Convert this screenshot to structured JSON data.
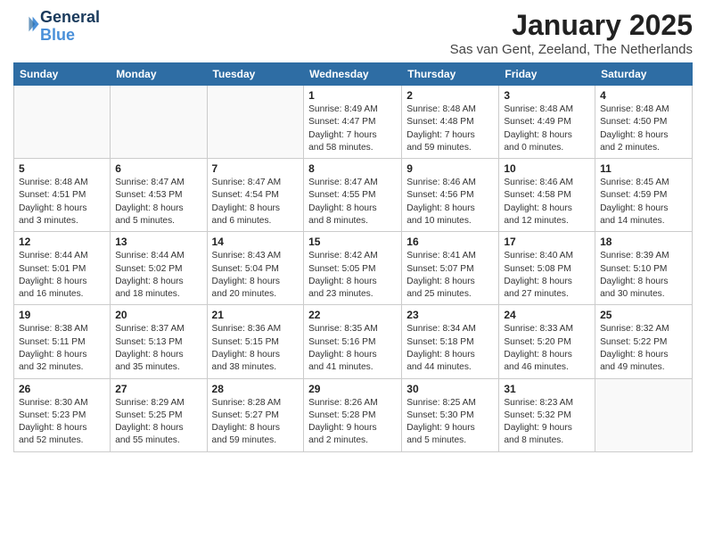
{
  "header": {
    "logo_line1": "General",
    "logo_line2": "Blue",
    "month_year": "January 2025",
    "location": "Sas van Gent, Zeeland, The Netherlands"
  },
  "weekdays": [
    "Sunday",
    "Monday",
    "Tuesday",
    "Wednesday",
    "Thursday",
    "Friday",
    "Saturday"
  ],
  "weeks": [
    [
      {
        "day": "",
        "info": ""
      },
      {
        "day": "",
        "info": ""
      },
      {
        "day": "",
        "info": ""
      },
      {
        "day": "1",
        "info": "Sunrise: 8:49 AM\nSunset: 4:47 PM\nDaylight: 7 hours\nand 58 minutes."
      },
      {
        "day": "2",
        "info": "Sunrise: 8:48 AM\nSunset: 4:48 PM\nDaylight: 7 hours\nand 59 minutes."
      },
      {
        "day": "3",
        "info": "Sunrise: 8:48 AM\nSunset: 4:49 PM\nDaylight: 8 hours\nand 0 minutes."
      },
      {
        "day": "4",
        "info": "Sunrise: 8:48 AM\nSunset: 4:50 PM\nDaylight: 8 hours\nand 2 minutes."
      }
    ],
    [
      {
        "day": "5",
        "info": "Sunrise: 8:48 AM\nSunset: 4:51 PM\nDaylight: 8 hours\nand 3 minutes."
      },
      {
        "day": "6",
        "info": "Sunrise: 8:47 AM\nSunset: 4:53 PM\nDaylight: 8 hours\nand 5 minutes."
      },
      {
        "day": "7",
        "info": "Sunrise: 8:47 AM\nSunset: 4:54 PM\nDaylight: 8 hours\nand 6 minutes."
      },
      {
        "day": "8",
        "info": "Sunrise: 8:47 AM\nSunset: 4:55 PM\nDaylight: 8 hours\nand 8 minutes."
      },
      {
        "day": "9",
        "info": "Sunrise: 8:46 AM\nSunset: 4:56 PM\nDaylight: 8 hours\nand 10 minutes."
      },
      {
        "day": "10",
        "info": "Sunrise: 8:46 AM\nSunset: 4:58 PM\nDaylight: 8 hours\nand 12 minutes."
      },
      {
        "day": "11",
        "info": "Sunrise: 8:45 AM\nSunset: 4:59 PM\nDaylight: 8 hours\nand 14 minutes."
      }
    ],
    [
      {
        "day": "12",
        "info": "Sunrise: 8:44 AM\nSunset: 5:01 PM\nDaylight: 8 hours\nand 16 minutes."
      },
      {
        "day": "13",
        "info": "Sunrise: 8:44 AM\nSunset: 5:02 PM\nDaylight: 8 hours\nand 18 minutes."
      },
      {
        "day": "14",
        "info": "Sunrise: 8:43 AM\nSunset: 5:04 PM\nDaylight: 8 hours\nand 20 minutes."
      },
      {
        "day": "15",
        "info": "Sunrise: 8:42 AM\nSunset: 5:05 PM\nDaylight: 8 hours\nand 23 minutes."
      },
      {
        "day": "16",
        "info": "Sunrise: 8:41 AM\nSunset: 5:07 PM\nDaylight: 8 hours\nand 25 minutes."
      },
      {
        "day": "17",
        "info": "Sunrise: 8:40 AM\nSunset: 5:08 PM\nDaylight: 8 hours\nand 27 minutes."
      },
      {
        "day": "18",
        "info": "Sunrise: 8:39 AM\nSunset: 5:10 PM\nDaylight: 8 hours\nand 30 minutes."
      }
    ],
    [
      {
        "day": "19",
        "info": "Sunrise: 8:38 AM\nSunset: 5:11 PM\nDaylight: 8 hours\nand 32 minutes."
      },
      {
        "day": "20",
        "info": "Sunrise: 8:37 AM\nSunset: 5:13 PM\nDaylight: 8 hours\nand 35 minutes."
      },
      {
        "day": "21",
        "info": "Sunrise: 8:36 AM\nSunset: 5:15 PM\nDaylight: 8 hours\nand 38 minutes."
      },
      {
        "day": "22",
        "info": "Sunrise: 8:35 AM\nSunset: 5:16 PM\nDaylight: 8 hours\nand 41 minutes."
      },
      {
        "day": "23",
        "info": "Sunrise: 8:34 AM\nSunset: 5:18 PM\nDaylight: 8 hours\nand 44 minutes."
      },
      {
        "day": "24",
        "info": "Sunrise: 8:33 AM\nSunset: 5:20 PM\nDaylight: 8 hours\nand 46 minutes."
      },
      {
        "day": "25",
        "info": "Sunrise: 8:32 AM\nSunset: 5:22 PM\nDaylight: 8 hours\nand 49 minutes."
      }
    ],
    [
      {
        "day": "26",
        "info": "Sunrise: 8:30 AM\nSunset: 5:23 PM\nDaylight: 8 hours\nand 52 minutes."
      },
      {
        "day": "27",
        "info": "Sunrise: 8:29 AM\nSunset: 5:25 PM\nDaylight: 8 hours\nand 55 minutes."
      },
      {
        "day": "28",
        "info": "Sunrise: 8:28 AM\nSunset: 5:27 PM\nDaylight: 8 hours\nand 59 minutes."
      },
      {
        "day": "29",
        "info": "Sunrise: 8:26 AM\nSunset: 5:28 PM\nDaylight: 9 hours\nand 2 minutes."
      },
      {
        "day": "30",
        "info": "Sunrise: 8:25 AM\nSunset: 5:30 PM\nDaylight: 9 hours\nand 5 minutes."
      },
      {
        "day": "31",
        "info": "Sunrise: 8:23 AM\nSunset: 5:32 PM\nDaylight: 9 hours\nand 8 minutes."
      },
      {
        "day": "",
        "info": ""
      }
    ]
  ]
}
